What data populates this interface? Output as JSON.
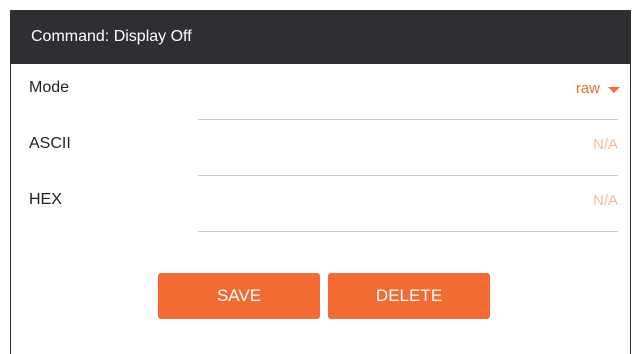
{
  "dialog": {
    "title": "Command: Display Off"
  },
  "fields": [
    {
      "label": "Mode",
      "value": "raw"
    },
    {
      "label": "ASCII",
      "value": "N/A"
    },
    {
      "label": "HEX",
      "value": "N/A"
    }
  ],
  "actions": {
    "save_label": "SAVE",
    "delete_label": "DELETE"
  },
  "colors": {
    "header_bg": "#2f2f33",
    "accent": "#f26b33",
    "placeholder": "#f9b99b"
  }
}
